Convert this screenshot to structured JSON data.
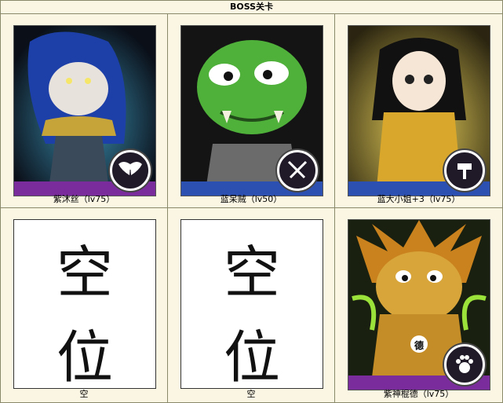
{
  "header": {
    "title": "BOSS关卡"
  },
  "slots": [
    {
      "label": "紫沐丝（lv75）",
      "portrait": "blue-haired-pale-warrior",
      "class_icon": "wings-icon",
      "band_color": "#7a2c9c"
    },
    {
      "label": "蓝呆贼（lv50）",
      "portrait": "green-orc-rogue",
      "class_icon": "crossed-daggers-icon",
      "band_color": "#2c4fb2"
    },
    {
      "label": "蓝大小姐+3（lv75）",
      "portrait": "golden-armored-lady",
      "class_icon": "hammer-icon",
      "band_color": "#2c4fb2"
    },
    {
      "label": "空",
      "empty_top": "空",
      "empty_bottom": "位"
    },
    {
      "label": "空",
      "empty_top": "空",
      "empty_bottom": "位"
    },
    {
      "label": "紫神棍德（lv75）",
      "portrait": "golden-tree-druid",
      "class_icon": "paw-icon",
      "band_color": "#7a2c9c",
      "badge_text": "德"
    }
  ]
}
